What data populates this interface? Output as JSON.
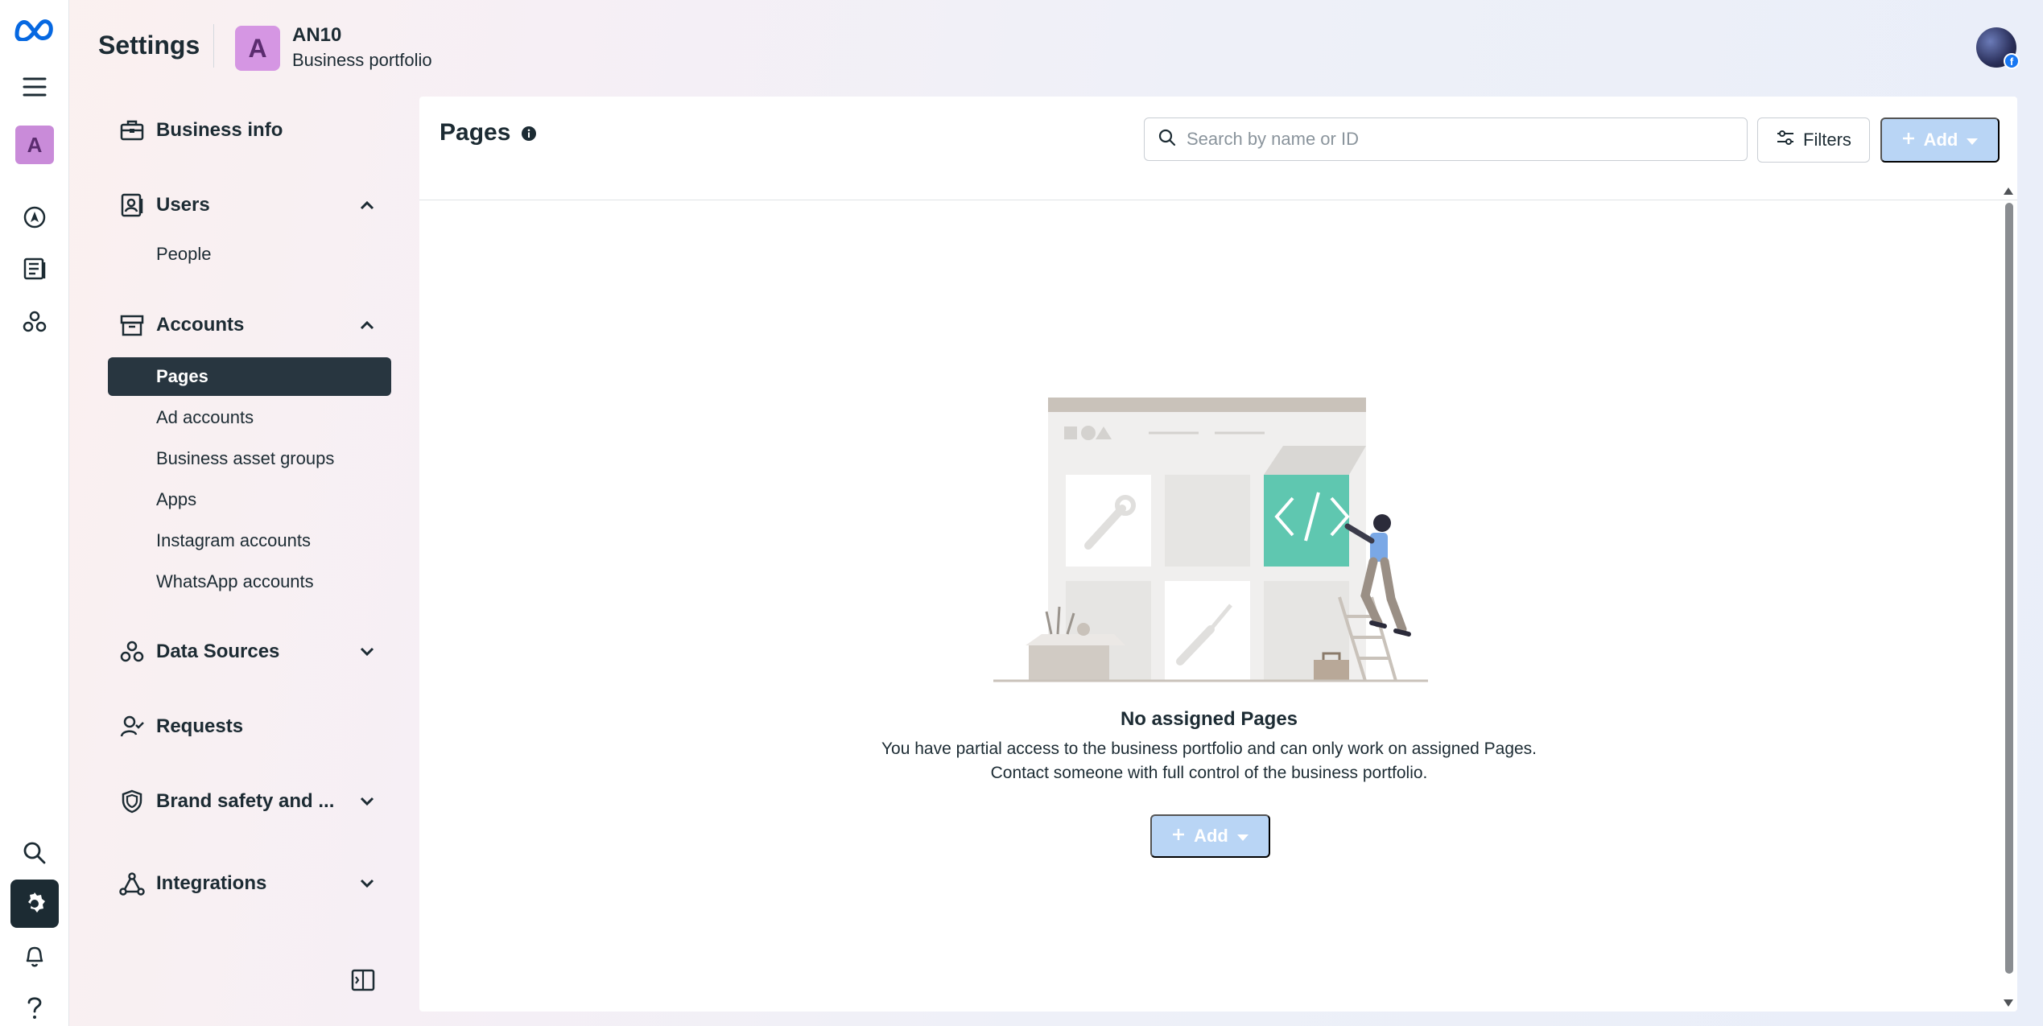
{
  "header": {
    "title": "Settings",
    "portfolio_initial": "A",
    "portfolio_name": "AN10",
    "portfolio_type": "Business portfolio"
  },
  "rail": {
    "workspace_initial": "A",
    "icons": [
      "meta-logo-icon",
      "menu-icon",
      "workspace-avatar",
      "compass-icon",
      "catalog-icon",
      "data-sources-icon",
      "search-icon",
      "settings-gear-icon",
      "notifications-bell-icon",
      "help-icon"
    ]
  },
  "nav": {
    "business_info": "Business info",
    "users": "Users",
    "people": "People",
    "accounts": "Accounts",
    "account_items": [
      "Pages",
      "Ad accounts",
      "Business asset groups",
      "Apps",
      "Instagram accounts",
      "WhatsApp accounts"
    ],
    "active_item": "Pages",
    "data_sources": "Data Sources",
    "requests": "Requests",
    "brand_safety": "Brand safety and ...",
    "integrations": "Integrations"
  },
  "main": {
    "title": "Pages",
    "search_placeholder": "Search by name or ID",
    "filters_label": "Filters",
    "add_label": "Add",
    "empty_title": "No assigned Pages",
    "empty_description": "You have partial access to the business portfolio and can only work on assigned Pages. Contact someone with full control of the business portfolio."
  },
  "colors": {
    "accent_dark": "#1c2b33",
    "active_nav_bg": "#283640",
    "disabled_button": "#b9d5f5",
    "portfolio_avatar": "#d596e3",
    "illustration_teal": "#5fc7b0"
  }
}
